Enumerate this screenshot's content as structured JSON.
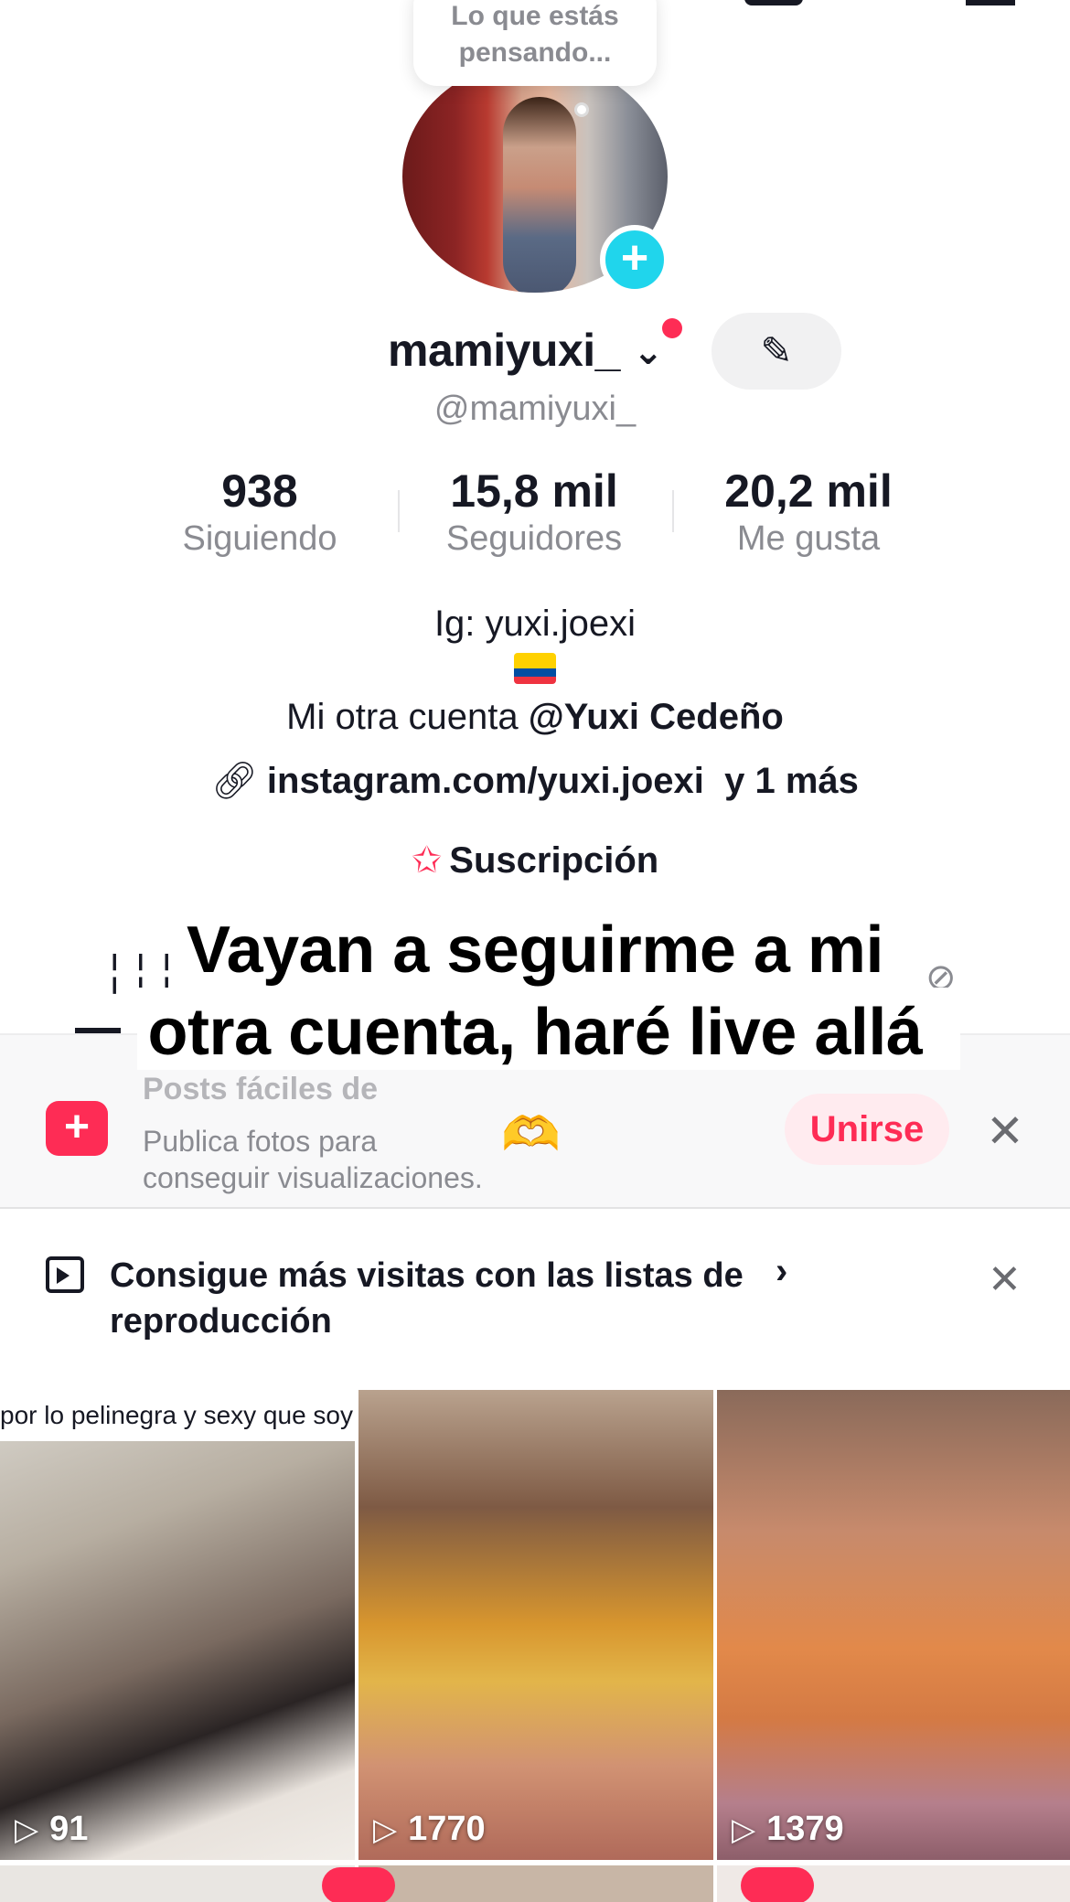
{
  "thought_bubble": {
    "text_line1": "Lo que estás",
    "text_line2": "pensando..."
  },
  "profile": {
    "display_name": "mamiyuxi_",
    "handle": "@mamiyuxi_",
    "add_icon": "plus-icon"
  },
  "stats": [
    {
      "value": "938",
      "label": "Siguiendo"
    },
    {
      "value": "15,8 mil",
      "label": "Seguidores"
    },
    {
      "value": "20,2 mil",
      "label": "Me gusta"
    }
  ],
  "bio": {
    "line1": "Ig: yuxi.joexi",
    "line3_prefix": "Mi otra cuenta ",
    "line3_mention": "@Yuxi Cedeño",
    "link": "instagram.com/yuxi.joexi",
    "link_more": "y 1 más",
    "subscription": "Suscripción"
  },
  "caption": {
    "line1": "Vayan a seguirme a mi",
    "line2": "otra cuenta, haré live allá"
  },
  "banner_post": {
    "title_partial": "Posts fáciles de",
    "description": "Publica fotos para conseguir visualizaciones.",
    "emoji": "🫶",
    "join_label": "Unirse"
  },
  "banner_playlist": {
    "text": "Consigue más visitas con las listas de reproducción"
  },
  "videos": [
    {
      "caption": "por lo pelinegra y sexy que soy",
      "views": "91"
    },
    {
      "caption": "",
      "views": "1770"
    },
    {
      "caption": "",
      "views": "1379"
    }
  ],
  "colors": {
    "accent": "#fe2c55",
    "cyan": "#20d5ec",
    "muted_text": "#8a8b91"
  }
}
